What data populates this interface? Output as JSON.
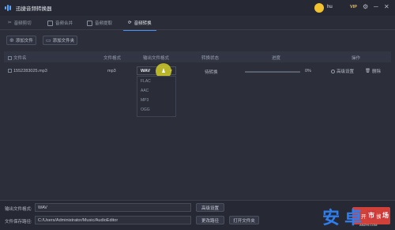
{
  "app": {
    "title": "迅捷音频转换器"
  },
  "user": {
    "name": "hu",
    "vip_label": "VIP"
  },
  "window_controls": {
    "settings": "⚙",
    "minimize": "─",
    "close": "✕"
  },
  "tabs": [
    {
      "label": "音频剪切",
      "active": false
    },
    {
      "label": "音频合并",
      "active": false
    },
    {
      "label": "音频提取",
      "active": false
    },
    {
      "label": "音频转换",
      "active": true
    }
  ],
  "toolbar": {
    "add_file": "添加文件",
    "add_folder": "添加文件夹"
  },
  "table": {
    "headers": {
      "filename": "文件名",
      "format": "文件格式",
      "output_format": "输出文件格式",
      "status": "转换状态",
      "progress": "进度",
      "actions": "操作"
    },
    "rows": [
      {
        "filename": "1552283025.mp3",
        "format": "mp3",
        "output_format": "WAV",
        "status": "待转换",
        "progress": "0%",
        "progress_value": 0,
        "settings": "高级设置",
        "delete": "删除"
      }
    ]
  },
  "dropdown": {
    "options": [
      "FLAC",
      "AAC",
      "MP3",
      "OGG"
    ]
  },
  "bottom": {
    "output_format_label": "输出文件格式:",
    "output_format_value": "WAV",
    "advanced_settings": "高级设置",
    "save_path_label": "文件保存路径:",
    "save_path_value": "C:/Users/Administrator/Music/AudioEditor",
    "change_path": "更改路径",
    "open_folder": "打开文件夹"
  },
  "start_button": {
    "label": "开始转换"
  },
  "watermark": {
    "main": "安卓",
    "badge1": "市",
    "badge2": "场",
    "sub": "ANZHI.COM"
  },
  "colors": {
    "accent": "#4a90ff",
    "start": "#d0413a",
    "avatar": "#f2c230",
    "vip": "#f0c040"
  }
}
